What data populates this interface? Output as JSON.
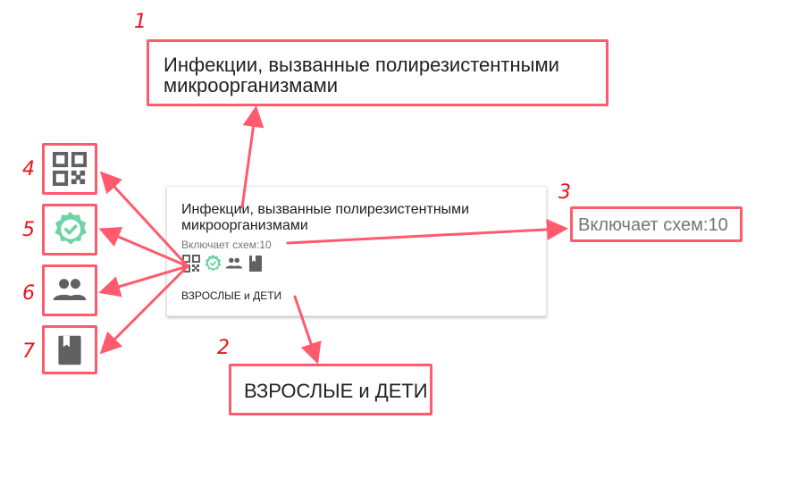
{
  "card": {
    "title": "Инфекции, вызванные полирезистентными микроорганизмами",
    "subtitle": "Включает схем:10",
    "audience": "ВЗРОСЛЫЕ и ДЕТИ",
    "icons": [
      "qr-code-icon",
      "verified-check-icon",
      "people-icon",
      "book-icon"
    ]
  },
  "callouts": {
    "c1": {
      "number": "1",
      "text": "Инфекции, вызванные полирезистентными микроорганизмами"
    },
    "c2": {
      "number": "2",
      "text": "ВЗРОСЛЫЕ и ДЕТИ"
    },
    "c3": {
      "number": "3",
      "text": "Включает схем:10"
    },
    "c4": {
      "number": "4",
      "icon": "qr-code-icon"
    },
    "c5": {
      "number": "5",
      "icon": "verified-check-icon"
    },
    "c6": {
      "number": "6",
      "icon": "people-icon"
    },
    "c7": {
      "number": "7",
      "icon": "book-icon"
    }
  },
  "colors": {
    "annotation": "#ff5a6e",
    "number": "#e8141e",
    "check": "#6fd3a6",
    "icon_gray": "#616161"
  }
}
